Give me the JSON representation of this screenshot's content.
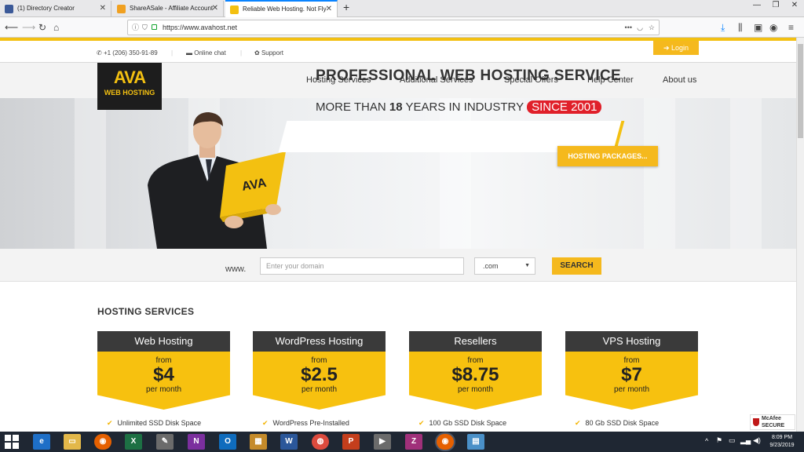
{
  "browser": {
    "tabs": [
      {
        "title": "(1) Directory Creator",
        "favicon_color": "#3b5998",
        "active": false
      },
      {
        "title": "ShareASale - Affiliate Account",
        "favicon_color": "#f0a020",
        "active": false
      },
      {
        "title": "Reliable Web Hosting. Not Fly",
        "favicon_color": "#f3c011",
        "active": true
      }
    ],
    "url": "https://www.avahost.net"
  },
  "topbar": {
    "phone": "+1 (206) 350-91-89",
    "chat": "Online chat",
    "support": "Support",
    "login": "Login"
  },
  "logo": {
    "mark": "AVA",
    "text": "WEB HOSTING"
  },
  "menu": [
    "Hosting Services",
    "Additional Services",
    "Special Offers",
    "Help Center",
    "About us"
  ],
  "hero": {
    "title": "PROFESSIONAL WEB HOSTING SERVICE",
    "sub_pre": "MORE THAN ",
    "sub_num": "18",
    "sub_post": " YEARS IN INDUSTRY",
    "since": "SINCE 2001",
    "cta": "HOSTING PACKAGES..."
  },
  "domain_search": {
    "prefix": "www.",
    "placeholder": "Enter your domain",
    "tld": ".com",
    "button": "SEARCH"
  },
  "hosting": {
    "section_title": "HOSTING SERVICES",
    "cards": [
      {
        "name": "Web Hosting",
        "from": "from",
        "price": "$4",
        "per": "per month",
        "feature": "Unlimited SSD Disk Space"
      },
      {
        "name": "WordPress Hosting",
        "from": "from",
        "price": "$2.5",
        "per": "per month",
        "feature": "WordPress Pre-Installed"
      },
      {
        "name": "Resellers",
        "from": "from",
        "price": "$8.75",
        "per": "per month",
        "feature": "100 Gb SSD Disk Space"
      },
      {
        "name": "VPS Hosting",
        "from": "from",
        "price": "$7",
        "per": "per month",
        "feature": "80 Gb SSD Disk Space"
      }
    ]
  },
  "badge": {
    "line1": "McAfee",
    "line2": "SECURE"
  },
  "taskbar": {
    "time": "8:09 PM",
    "date": "9/23/2019"
  }
}
